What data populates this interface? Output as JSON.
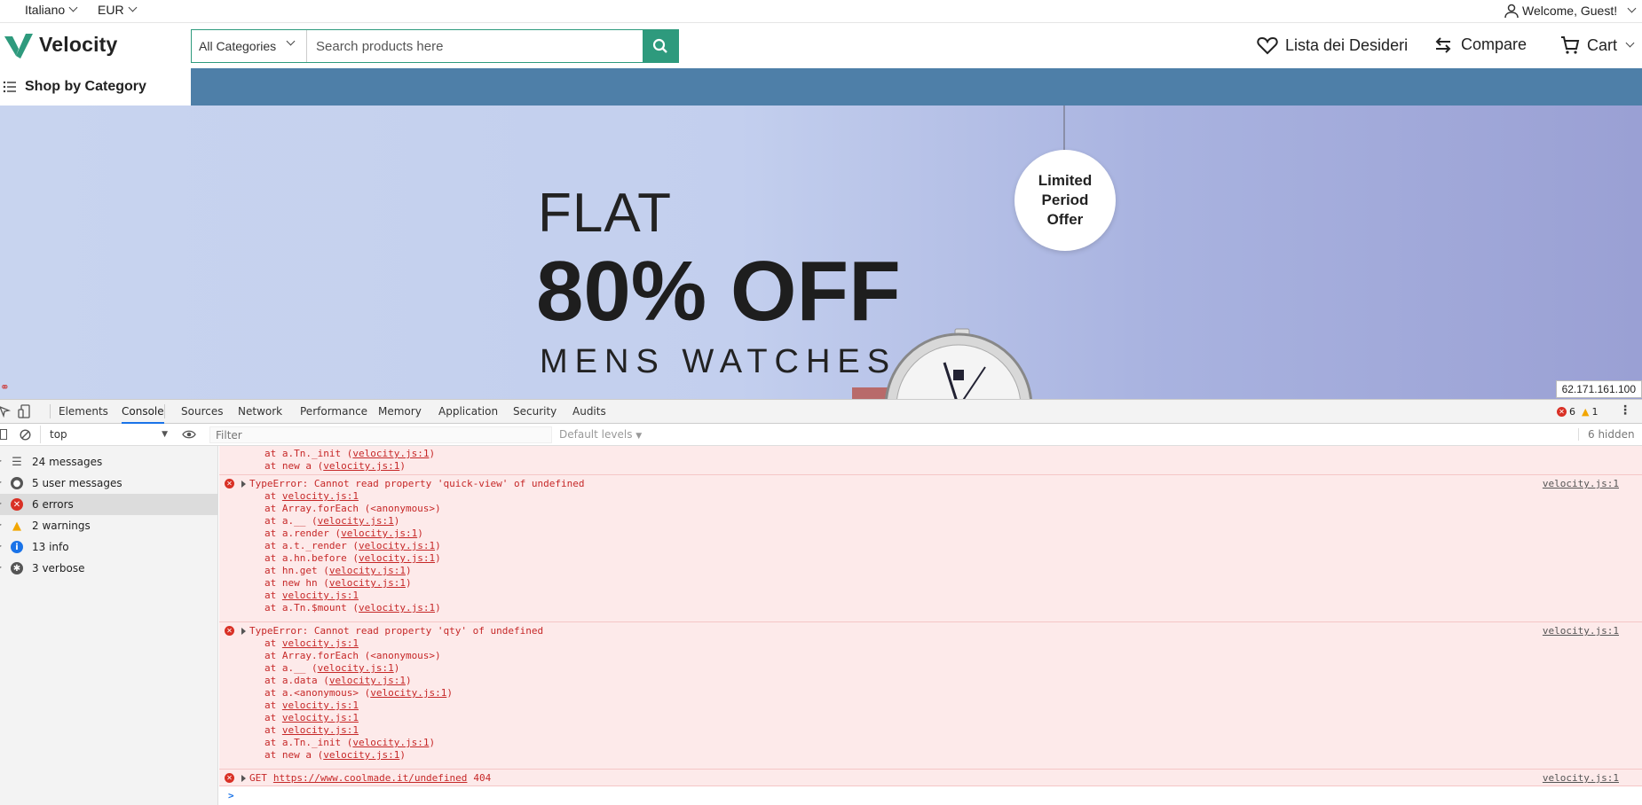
{
  "topbar": {
    "language": "Italiano",
    "currency": "EUR",
    "welcome": "Welcome, Guest!"
  },
  "header": {
    "logo": "Velocity",
    "search_category": "All Categories",
    "search_placeholder": "Search products here",
    "wishlist": "Lista dei Desideri",
    "compare": "Compare",
    "cart": "Cart"
  },
  "nav": {
    "shop_by_category": "Shop by Category"
  },
  "banner": {
    "flat": "FLAT",
    "off": "80% OFF",
    "subtitle": "MENS WATCHES",
    "tag": [
      "Limited",
      "Period",
      "Offer"
    ],
    "ip": "62.171.161.100"
  },
  "colors": {
    "brand": "#2e9a7d",
    "nav": "#4e7fa8",
    "error": "#d93025"
  },
  "devtools": {
    "tabs": [
      "Elements",
      "Console",
      "Sources",
      "Network",
      "Performance",
      "Memory",
      "Application",
      "Security",
      "Audits"
    ],
    "error_count": "6",
    "warning_count": "1",
    "context": "top",
    "filter_placeholder": "Filter",
    "levels": "Default levels",
    "hidden": "6 hidden",
    "sidebar": [
      {
        "label": "24 messages",
        "icon": "list-icon"
      },
      {
        "label": "5 user messages",
        "icon": "user-icon"
      },
      {
        "label": "6 errors",
        "icon": "error-icon"
      },
      {
        "label": "2 warnings",
        "icon": "warning-icon"
      },
      {
        "label": "13 info",
        "icon": "info-icon"
      },
      {
        "label": "3 verbose",
        "icon": "bug-icon"
      }
    ],
    "top_lines": [
      {
        "pre": "at a.Tn._init (",
        "link": "velocity.js:1",
        "post": ")"
      },
      {
        "pre": "at new a (",
        "link": "velocity.js:1",
        "post": ")"
      }
    ],
    "errors": [
      {
        "message": "TypeError: Cannot read property 'quick-view' of undefined",
        "source": "velocity.js:1",
        "stack": [
          {
            "pre": "at ",
            "link": "velocity.js:1",
            "post": ""
          },
          {
            "pre": "at Array.forEach (<anonymous>)",
            "link": "",
            "post": ""
          },
          {
            "pre": "at a.__ (",
            "link": "velocity.js:1",
            "post": ")"
          },
          {
            "pre": "at a.render (",
            "link": "velocity.js:1",
            "post": ")"
          },
          {
            "pre": "at a.t._render (",
            "link": "velocity.js:1",
            "post": ")"
          },
          {
            "pre": "at a.hn.before (",
            "link": "velocity.js:1",
            "post": ")"
          },
          {
            "pre": "at hn.get (",
            "link": "velocity.js:1",
            "post": ")"
          },
          {
            "pre": "at new hn (",
            "link": "velocity.js:1",
            "post": ")"
          },
          {
            "pre": "at ",
            "link": "velocity.js:1",
            "post": ""
          },
          {
            "pre": "at a.Tn.$mount (",
            "link": "velocity.js:1",
            "post": ")"
          }
        ]
      },
      {
        "message": "TypeError: Cannot read property 'qty' of undefined",
        "source": "velocity.js:1",
        "stack": [
          {
            "pre": "at ",
            "link": "velocity.js:1",
            "post": ""
          },
          {
            "pre": "at Array.forEach (<anonymous>)",
            "link": "",
            "post": ""
          },
          {
            "pre": "at a.__ (",
            "link": "velocity.js:1",
            "post": ")"
          },
          {
            "pre": "at a.data (",
            "link": "velocity.js:1",
            "post": ")"
          },
          {
            "pre": "at a.<anonymous> (",
            "link": "velocity.js:1",
            "post": ")"
          },
          {
            "pre": "at ",
            "link": "velocity.js:1",
            "post": ""
          },
          {
            "pre": "at ",
            "link": "velocity.js:1",
            "post": ""
          },
          {
            "pre": "at ",
            "link": "velocity.js:1",
            "post": ""
          },
          {
            "pre": "at a.Tn._init (",
            "link": "velocity.js:1",
            "post": ")"
          },
          {
            "pre": "at new a (",
            "link": "velocity.js:1",
            "post": ")"
          }
        ]
      }
    ],
    "get_error": {
      "method": "GET",
      "url": "https://www.coolmade.it/undefined",
      "status": "404",
      "source": "velocity.js:1"
    },
    "prompt": ">"
  }
}
